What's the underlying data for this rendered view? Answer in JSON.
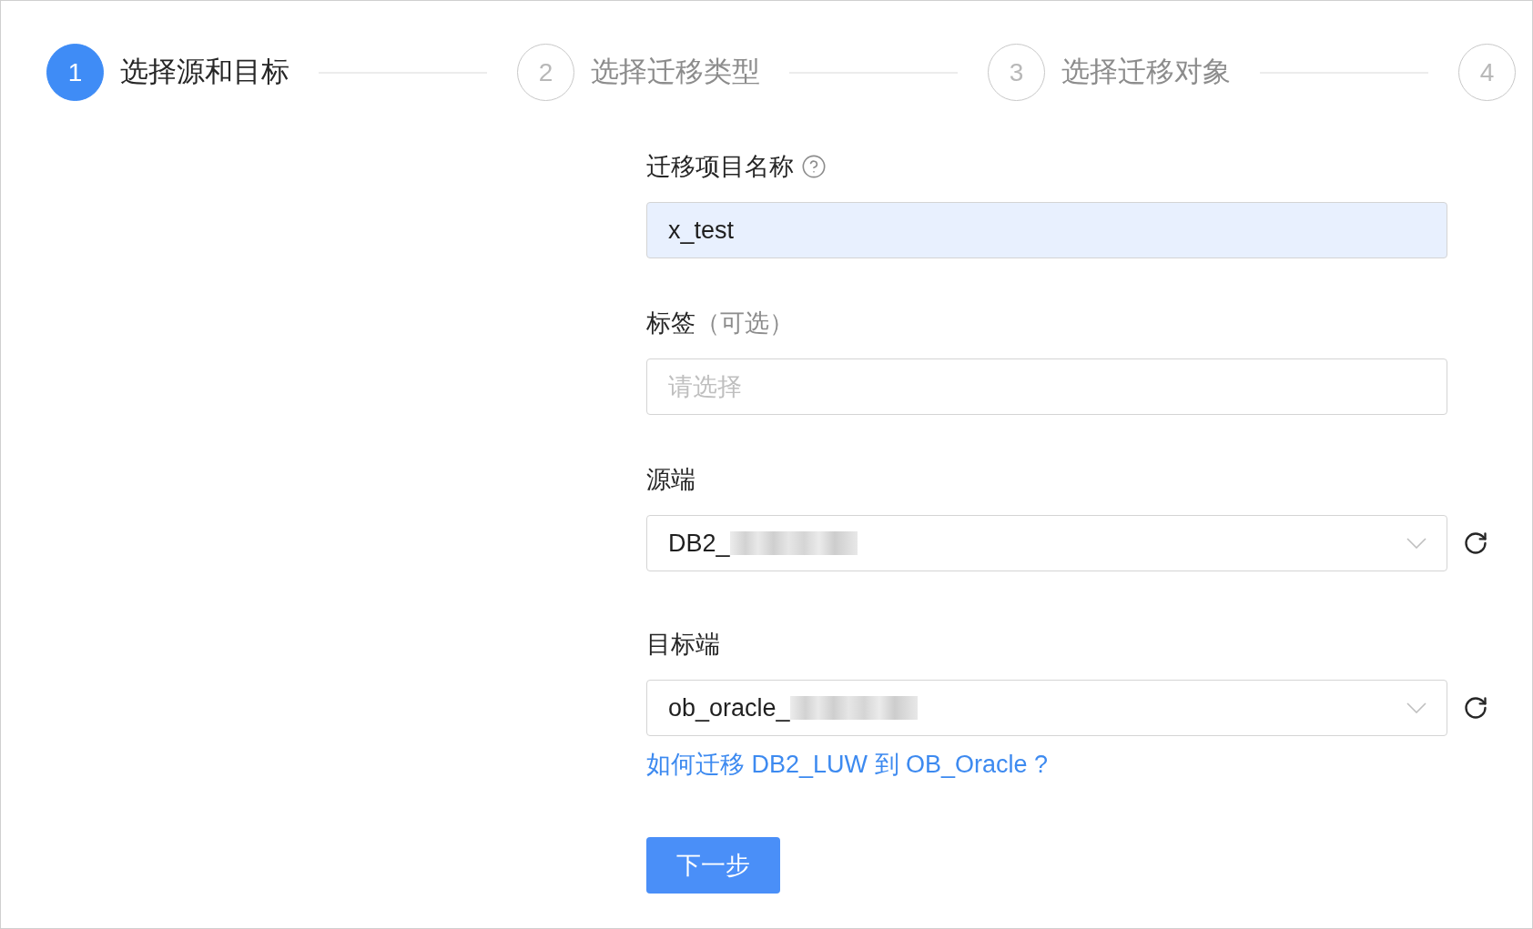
{
  "steps": [
    {
      "number": "1",
      "label": "选择源和目标",
      "selected": true
    },
    {
      "number": "2",
      "label": "选择迁移类型",
      "selected": false
    },
    {
      "number": "3",
      "label": "选择迁移对象",
      "selected": false
    },
    {
      "number": "4",
      "selected": false
    }
  ],
  "form": {
    "fields": [
      {
        "kind": "input",
        "label": "迁移项目名称",
        "help_icon": true,
        "value": "x_test",
        "autofilled": true
      },
      {
        "kind": "input",
        "label": "标签",
        "note": "（可选）",
        "placeholder": "请选择",
        "autofilled": false
      },
      {
        "kind": "select",
        "label": "源端",
        "value": "DB2_",
        "redacted": true
      },
      {
        "kind": "select",
        "label": "目标端",
        "value": "ob_oracle_",
        "redacted": true,
        "help_link": "如何迁移 DB2_LUW 到 OB_Oracle ?"
      }
    ],
    "next_button": "下一步"
  }
}
